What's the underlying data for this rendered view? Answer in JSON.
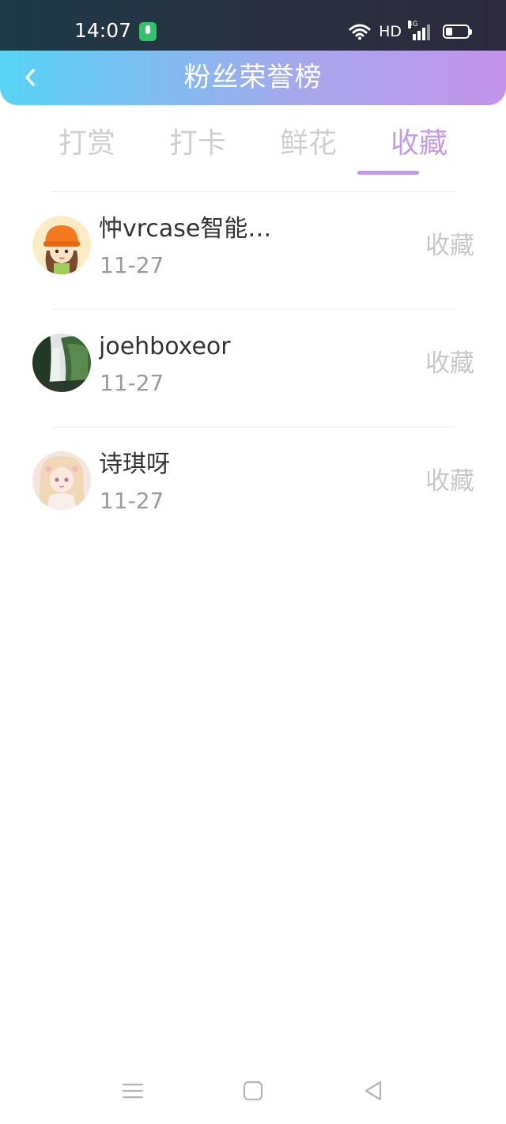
{
  "status_bar": {
    "time": "14:07",
    "network": "HD",
    "signal_type": "4G",
    "mic_icon_color": "#33c16a"
  },
  "header": {
    "title": "粉丝荣誉榜",
    "gradient": [
      "#57d3f5",
      "#a9a6ec",
      "#c294ea"
    ]
  },
  "tabs": [
    {
      "label": "打赏",
      "active": false
    },
    {
      "label": "打卡",
      "active": false
    },
    {
      "label": "鲜花",
      "active": false
    },
    {
      "label": "收藏",
      "active": true
    }
  ],
  "accent_color": "#c49ce6",
  "list": [
    {
      "name": "忡vrcase智能…",
      "date": "11-27",
      "action": "收藏",
      "avatar": "cartoon-girl-orange-hat-avatar"
    },
    {
      "name": "joehboxeor",
      "date": "11-27",
      "action": "收藏",
      "avatar": "waterfall-landscape-avatar"
    },
    {
      "name": "诗琪呀",
      "date": "11-27",
      "action": "收藏",
      "avatar": "anime-girl-avatar"
    }
  ],
  "nav": {
    "menu_icon": "menu-icon",
    "home_icon": "home-icon",
    "back_icon": "back-triangle-icon"
  }
}
